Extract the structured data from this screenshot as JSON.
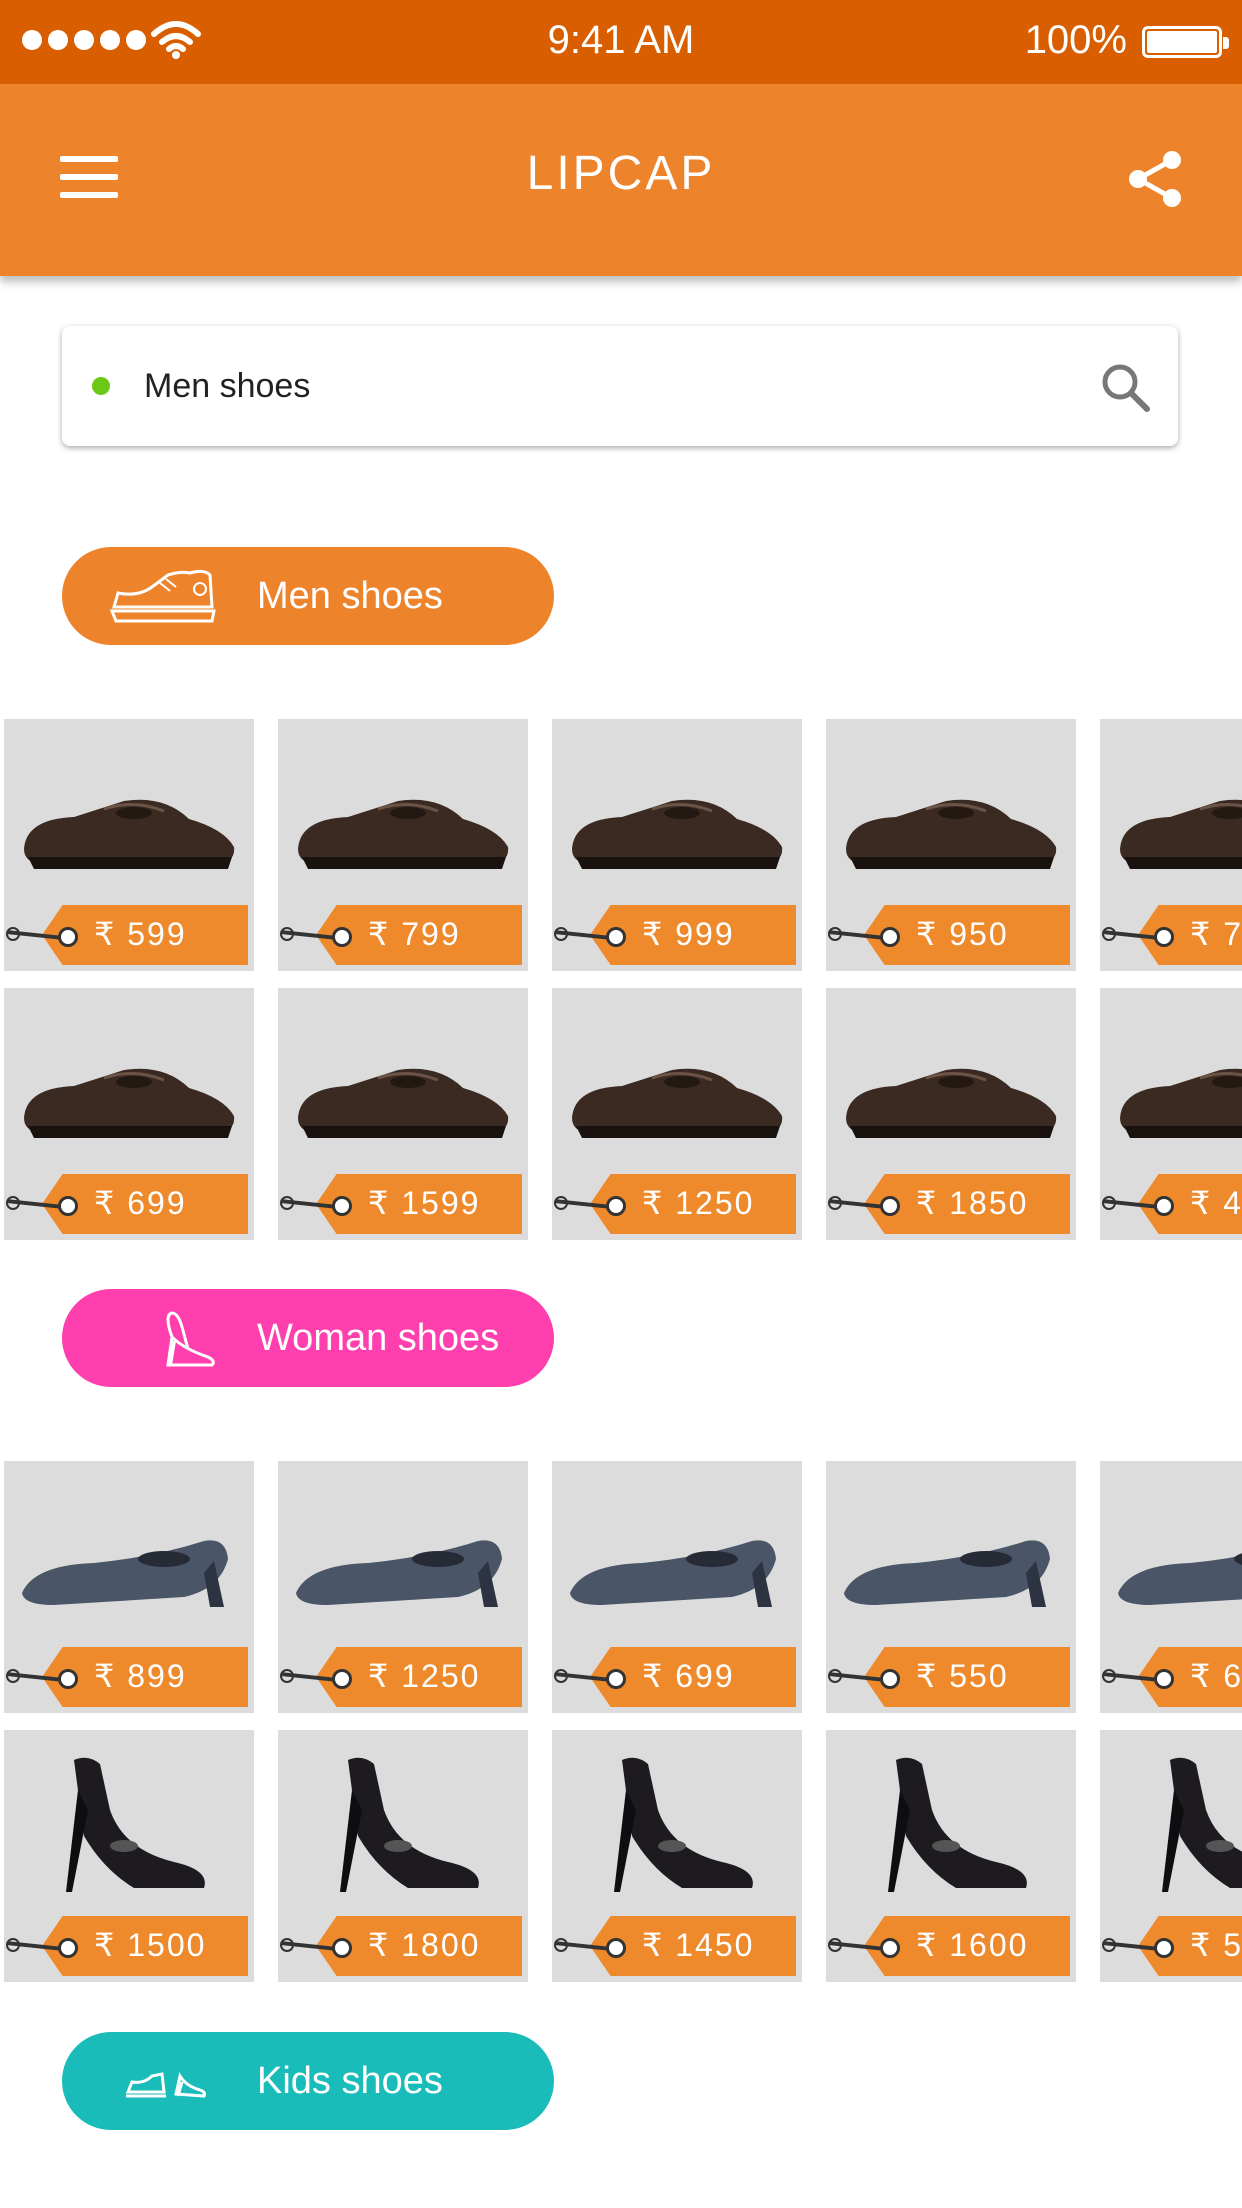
{
  "status_bar": {
    "time": "9:41 AM",
    "battery": "100%"
  },
  "app_bar": {
    "title": "LIPCAP"
  },
  "search": {
    "value": "Men shoes",
    "indicator_color": "#6cc817"
  },
  "currency": "₹",
  "colors": {
    "status_bar": "#d95e00",
    "app_bar": "#ed842b",
    "tag": "#ef8a2c",
    "tile": "#dcdcdc"
  },
  "sections": {
    "men": {
      "label": "Men shoes",
      "color": "#ed842b",
      "icon": "sneaker-icon",
      "rows": [
        [
          "599",
          "799",
          "999",
          "950",
          "7"
        ],
        [
          "699",
          "1599",
          "1250",
          "1850",
          "4"
        ]
      ]
    },
    "woman": {
      "label": "Woman shoes",
      "color": "#ff3fae",
      "icon": "high-heel-icon",
      "rows": [
        [
          "899",
          "1250",
          "699",
          "550",
          "6"
        ],
        [
          "1500",
          "1800",
          "1450",
          "1600",
          "5"
        ]
      ]
    },
    "kids": {
      "label": "Kids shoes",
      "color": "#19bcb8",
      "icon": "kids-shoes-icon"
    }
  }
}
